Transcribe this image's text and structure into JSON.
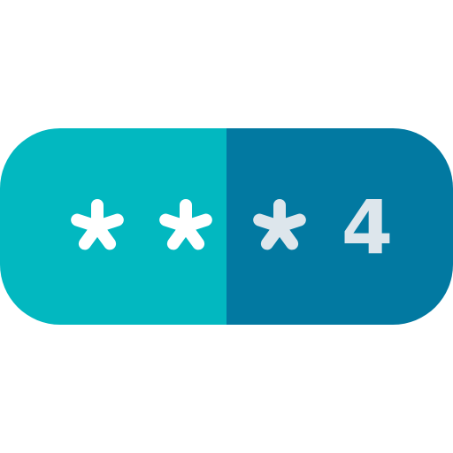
{
  "pin_field": {
    "masked_chars": [
      "*",
      "*",
      "*"
    ],
    "visible_digit": "4"
  },
  "icons": {
    "mask": "asterisk-icon"
  },
  "colors": {
    "left_bg": "#02b8c0",
    "right_bg": "#0279a1",
    "glyph_white": "#ffffff",
    "glyph_light": "#dde6ec"
  }
}
